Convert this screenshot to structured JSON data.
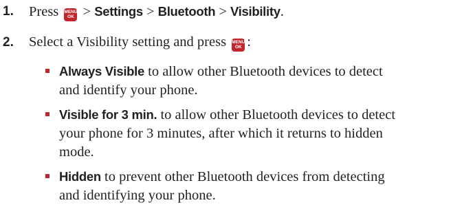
{
  "steps": [
    {
      "number": "1.",
      "text_press": "Press",
      "sep1": ">",
      "settings": "Settings",
      "sep2": ">",
      "bluetooth": "Bluetooth",
      "sep3": ">",
      "visibility": "Visibility",
      "end": "."
    },
    {
      "number": "2.",
      "text": "Select a Visibility setting and press",
      "end": ":"
    }
  ],
  "menu_key": {
    "line1": "MENU",
    "line2": "OK"
  },
  "options": [
    {
      "term": "Always Visible",
      "line1": " to allow other Bluetooth devices to detect",
      "line2": "and identify your phone."
    },
    {
      "term": "Visible for 3 min.",
      "line1": " to allow other Bluetooth devices to detect",
      "line2": "your phone for 3 minutes, after which it returns to hidden",
      "line3": "mode."
    },
    {
      "term": "Hidden",
      "line1": " to prevent other Bluetooth devices from detecting",
      "line2": "and identifying your phone."
    }
  ],
  "colors": {
    "accent": "#c0272d",
    "text": "#231f20"
  }
}
